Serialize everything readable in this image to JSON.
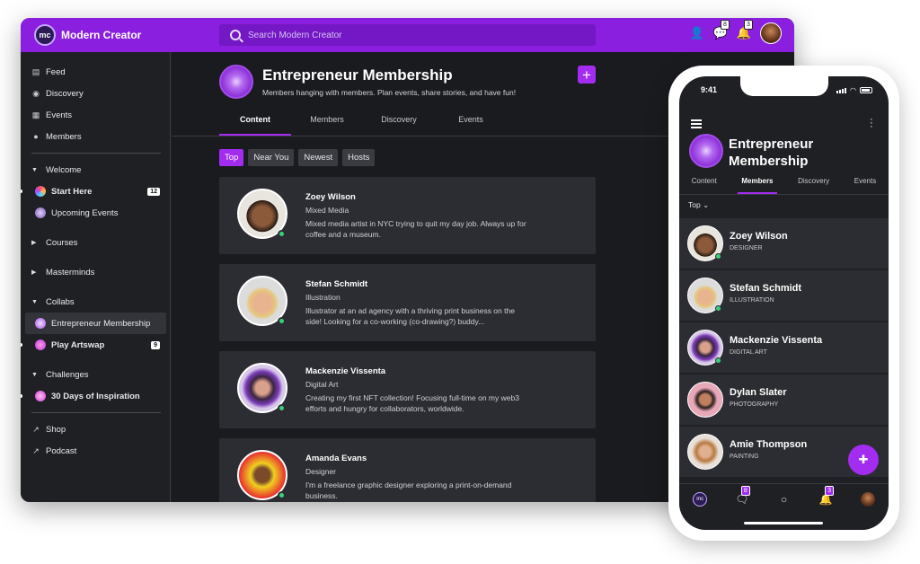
{
  "app": {
    "brand": "Modern Creator",
    "logo_text": "mc"
  },
  "search": {
    "placeholder": "Search Modern Creator"
  },
  "topbar": {
    "messages_count": "8",
    "notifications_count": "3"
  },
  "sidebar": {
    "feed": "Feed",
    "discovery": "Discovery",
    "events": "Events",
    "members": "Members",
    "welcome": "Welcome",
    "start_here": "Start Here",
    "start_here_count": "12",
    "upcoming_events": "Upcoming Events",
    "courses": "Courses",
    "masterminds": "Masterminds",
    "collabs": "Collabs",
    "entrepreneur_membership": "Entrepreneur Membership",
    "play_artswap": "Play Artswap",
    "play_artswap_count": "9",
    "challenges": "Challenges",
    "thirty_days": "30 Days of Inspiration",
    "shop": "Shop",
    "podcast": "Podcast"
  },
  "space": {
    "title": "Entrepreneur Membership",
    "description": "Members hanging with members. Plan events, share stories, and have fun!",
    "tabs": [
      "Content",
      "Members",
      "Discovery",
      "Events"
    ],
    "filters": [
      "Top",
      "Near You",
      "Newest",
      "Hosts"
    ]
  },
  "members": [
    {
      "name": "Zoey Wilson",
      "role": "Mixed Media",
      "bio": "Mixed media artist in NYC trying to quit my day job. Always up for coffee and a museum."
    },
    {
      "name": "Stefan Schmidt",
      "role": "Illustration",
      "bio": "Illustrator at an ad agency with a thriving print business on the side! Looking for a co-working (co-drawing?) buddy..."
    },
    {
      "name": "Mackenzie Vissenta",
      "role": "Digital Art",
      "bio": "Creating my first NFT collection! Focusing full-time on my web3 efforts and hungry for collaborators, worldwide."
    },
    {
      "name": "Amanda Evans",
      "role": "Designer",
      "bio": "I'm a freelance graphic designer exploring a print-on-demand business."
    }
  ],
  "phone": {
    "time": "9:41",
    "title": "Entrepreneur Membership",
    "tabs": [
      "Content",
      "Members",
      "Discovery",
      "Events"
    ],
    "filter": "Top",
    "messages_count": "8",
    "notifications_count": "3",
    "members": [
      {
        "name": "Zoey Wilson",
        "role": "DESIGNER"
      },
      {
        "name": "Stefan Schmidt",
        "role": "ILLUSTRATION"
      },
      {
        "name": "Mackenzie Vissenta",
        "role": "DIGITAL ART"
      },
      {
        "name": "Dylan Slater",
        "role": "PHOTOGRAPHY"
      },
      {
        "name": "Amie Thompson",
        "role": "PAINTING"
      }
    ]
  },
  "colors": {
    "accent": "#a22cf0",
    "topbar": "#8a1fe0",
    "panel": "#2c2d32",
    "background": "#1f2024",
    "online": "#3ad07a"
  }
}
